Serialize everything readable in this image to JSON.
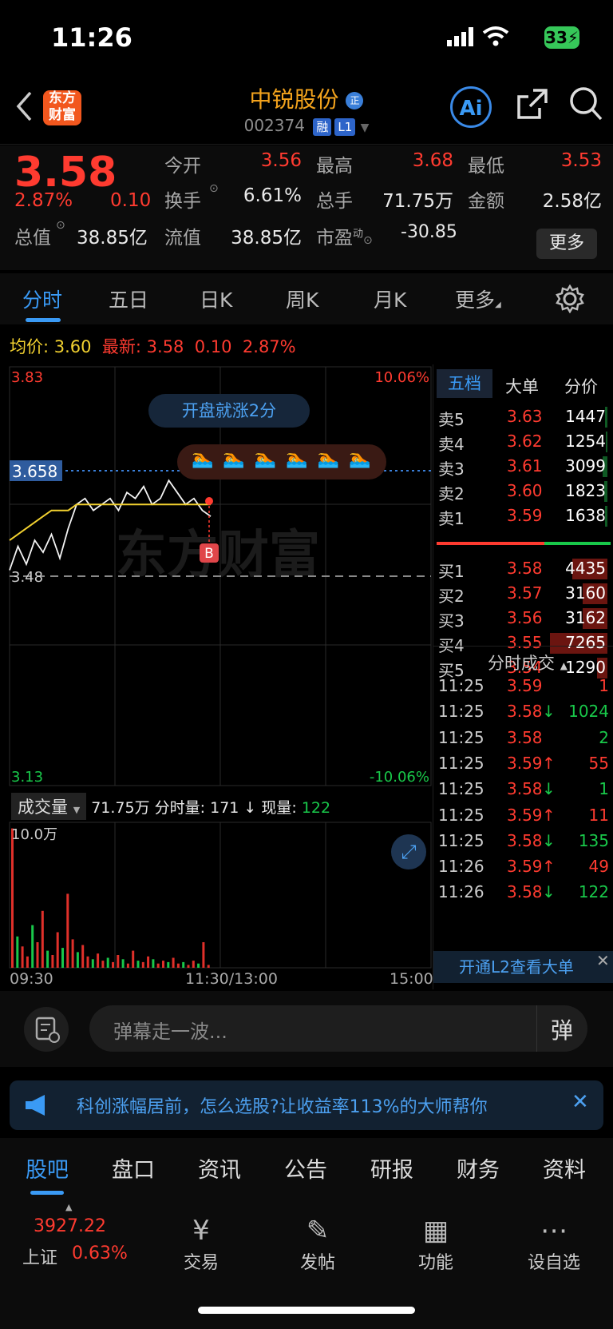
{
  "status_bar": {
    "time": "11:26",
    "battery": "33"
  },
  "header": {
    "logo_line1": "东方",
    "logo_line2": "财富",
    "stock_name": "中锐股份",
    "name_badge": "正",
    "stock_code": "002374",
    "tag_margin": "融",
    "tag_level": "L1",
    "ai_label": "Ai"
  },
  "quote": {
    "price": "3.58",
    "change_pct": "2.87%",
    "change": "0.10",
    "open_label": "今开",
    "open": "3.56",
    "high_label": "最高",
    "high": "3.68",
    "low_label": "最低",
    "low": "3.53",
    "turnover_label": "换手",
    "turnover": "6.61%",
    "volume_label": "总手",
    "volume": "71.75万",
    "amount_label": "金额",
    "amount": "2.58亿",
    "mktcap_label": "总值",
    "mktcap": "38.85亿",
    "float_label": "流值",
    "float": "38.85亿",
    "pe_label": "市盈",
    "pe_sup": "动",
    "pe": "-30.85",
    "more": "更多"
  },
  "chart_tabs": [
    "分时",
    "五日",
    "日K",
    "周K",
    "月K",
    "更多"
  ],
  "chart": {
    "avg_label": "均价:",
    "avg": "3.60",
    "latest_label": "最新:",
    "latest": "3.58",
    "latest_change": "0.10",
    "latest_pct": "2.87%",
    "y_top": "3.83",
    "y_bottom": "3.13",
    "pct_top": "10.06%",
    "pct_bottom": "-10.06%",
    "ref_price": "3.48",
    "cursor_price": "3.658",
    "pill_text": "开盘就涨2分",
    "buy_marker": "B",
    "watermark": "东方财富",
    "volume_selector": "成交量",
    "volume_total": "71.75万",
    "minute_vol_label": "分时量:",
    "minute_vol": "171",
    "current_vol_label": "现量:",
    "current_vol": "122",
    "vol_axis": "10.0万",
    "x_start": "09:30",
    "x_mid": "11:30/13:00",
    "x_end": "15:00"
  },
  "chart_data": {
    "type": "line",
    "ylim": [
      3.13,
      3.83
    ],
    "reference": 3.48,
    "x": [
      "09:30",
      "11:26"
    ],
    "series": [
      {
        "values": [
          3.49,
          3.53,
          3.5,
          3.54,
          3.52,
          3.55,
          3.51,
          3.56,
          3.6,
          3.61,
          3.59,
          3.6,
          3.61,
          3.59,
          3.62,
          3.61,
          3.63,
          3.6,
          3.61,
          3.64,
          3.62,
          3.6,
          3.61,
          3.59,
          3.58
        ]
      },
      {
        "values": [
          3.54,
          3.55,
          3.56,
          3.57,
          3.58,
          3.59,
          3.59,
          3.59,
          3.6,
          3.6,
          3.6,
          3.6,
          3.6,
          3.6,
          3.6,
          3.6,
          3.6,
          3.6,
          3.6,
          3.6,
          3.6,
          3.6,
          3.6,
          3.6,
          3.6
        ]
      }
    ],
    "volume_ylim": [
      0,
      100000
    ],
    "volume": [
      98000,
      22000,
      15000,
      8000,
      30000,
      18000,
      40000,
      12000,
      9000,
      25000,
      14000,
      52000,
      20000,
      11000,
      16000,
      8000,
      6000,
      10000,
      5000,
      7000,
      4000,
      9000,
      6000,
      3000,
      12000,
      5000,
      4000,
      8000,
      6000,
      3000,
      5000,
      4000,
      7000,
      3000,
      4000,
      2000,
      5000,
      3000,
      18000,
      2000
    ]
  },
  "order_book": {
    "tabs": [
      "五档",
      "大单",
      "分价"
    ],
    "sells": [
      {
        "label": "卖5",
        "price": "3.63",
        "vol": "1447"
      },
      {
        "label": "卖4",
        "price": "3.62",
        "vol": "1254"
      },
      {
        "label": "卖3",
        "price": "3.61",
        "vol": "3099"
      },
      {
        "label": "卖2",
        "price": "3.60",
        "vol": "1823"
      },
      {
        "label": "卖1",
        "price": "3.59",
        "vol": "1638"
      }
    ],
    "buys": [
      {
        "label": "买1",
        "price": "3.58",
        "vol": "4435"
      },
      {
        "label": "买2",
        "price": "3.57",
        "vol": "3160"
      },
      {
        "label": "买3",
        "price": "3.56",
        "vol": "3162"
      },
      {
        "label": "买4",
        "price": "3.55",
        "vol": "7265"
      },
      {
        "label": "买5",
        "price": "3.54",
        "vol": "1290"
      }
    ],
    "trades_title": "分时成交",
    "trades": [
      {
        "time": "11:25",
        "price": "3.59",
        "arrow": "",
        "vol": "1",
        "dir": "up"
      },
      {
        "time": "11:25",
        "price": "3.58",
        "arrow": "↓",
        "vol": "1024",
        "dir": "down"
      },
      {
        "time": "11:25",
        "price": "3.58",
        "arrow": "",
        "vol": "2",
        "dir": "down"
      },
      {
        "time": "11:25",
        "price": "3.59",
        "arrow": "↑",
        "vol": "55",
        "dir": "up"
      },
      {
        "time": "11:25",
        "price": "3.58",
        "arrow": "↓",
        "vol": "1",
        "dir": "down"
      },
      {
        "time": "11:25",
        "price": "3.59",
        "arrow": "↑",
        "vol": "11",
        "dir": "up"
      },
      {
        "time": "11:25",
        "price": "3.58",
        "arrow": "↓",
        "vol": "135",
        "dir": "down"
      },
      {
        "time": "11:26",
        "price": "3.59",
        "arrow": "↑",
        "vol": "49",
        "dir": "up"
      },
      {
        "time": "11:26",
        "price": "3.58",
        "arrow": "↓",
        "vol": "122",
        "dir": "down"
      }
    ],
    "l2_link": "开通L2查看大单"
  },
  "danmu": {
    "placeholder": "弹幕走一波...",
    "button": "弹"
  },
  "banner": {
    "text": "科创涨幅居前，怎么选股?让收益率113%的大师帮你"
  },
  "bottom_tabs": [
    "股吧",
    "盘口",
    "资讯",
    "公告",
    "研报",
    "财务",
    "资料"
  ],
  "toolbar": {
    "index_value": "3927.22",
    "index_name": "上证",
    "index_pct": "0.63%",
    "items": [
      "交易",
      "发帖",
      "功能",
      "设自选"
    ]
  },
  "colors": {
    "up": "#ff3b30",
    "down": "#19c84a",
    "accent": "#3a9af5",
    "name": "#f3a31d"
  }
}
